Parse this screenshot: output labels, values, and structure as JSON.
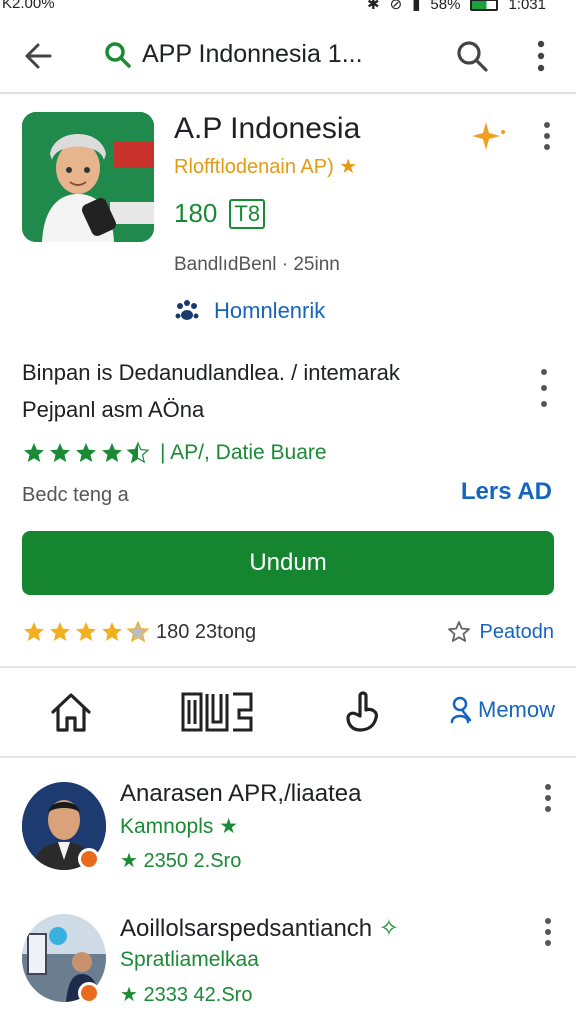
{
  "status_bar": {
    "left_text": "K2.00%",
    "battery": "58%",
    "time": "1:031"
  },
  "app_bar": {
    "search_title": "APP Indonnesia 1..."
  },
  "app": {
    "name": "A.P Indonesia",
    "developer": "Rlofftlodenain AP) ★",
    "size_number": "180",
    "size_badge": "T8",
    "meta": "BandlıdBenl · 25inn",
    "category": "Homnlenrik"
  },
  "description": {
    "line1": "Binpan is Dedanudlandlea. / intemarak",
    "line2": "Pejpanl asm AÖna"
  },
  "rating": {
    "stars": 4.5,
    "text": "| AP/, Datie Buare"
  },
  "installs_text": "Bedc teng a",
  "learn_more": "Lers AD",
  "install_button": "Undum",
  "reviews": {
    "stars": 4,
    "count_text": "180 23tong",
    "action": "Peatodn"
  },
  "nav": {
    "follow_label": "Memow"
  },
  "related": [
    {
      "title": "Anarasen APR,/liaatea",
      "subtitle": "Kamnopls ★",
      "rating": "★ 2350 2.Sro"
    },
    {
      "title": "Aoillolsarspedsantianch",
      "subtitle": "Spratliamelkaa",
      "rating": "★ 2333 42.Sro"
    }
  ],
  "colors": {
    "primary_green": "#15862f",
    "text_green": "#1a8a35",
    "link_blue": "#1565c0",
    "star_gold": "#f2b020",
    "developer_orange": "#e59a14"
  }
}
